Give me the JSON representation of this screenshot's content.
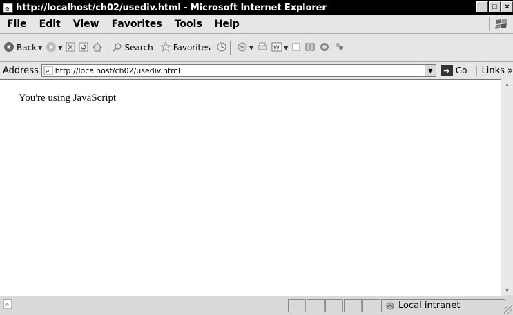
{
  "window": {
    "title": "http://localhost/ch02/usediv.html - Microsoft Internet Explorer",
    "controls": [
      "_",
      "□",
      "×"
    ]
  },
  "menu": {
    "items": [
      "File",
      "Edit",
      "View",
      "Favorites",
      "Tools",
      "Help"
    ]
  },
  "toolbar": {
    "back_label": "Back",
    "search_label": "Search",
    "favorites_label": "Favorites"
  },
  "address": {
    "label": "Address",
    "url": "http://localhost/ch02/usediv.html",
    "go_label": "Go",
    "links_label": "Links"
  },
  "page": {
    "text": "You're using JavaScript"
  },
  "status": {
    "zone_label": "Local intranet"
  },
  "icons": {
    "title": "ie-page-icon",
    "back": "back-arrow-icon",
    "forward": "forward-arrow-icon",
    "stop": "stop-icon",
    "refresh": "refresh-icon",
    "home": "home-icon",
    "search": "search-icon",
    "favorites": "star-icon",
    "history": "history-icon",
    "mail": "mail-icon",
    "print": "printer-icon",
    "edit": "word-edit-icon",
    "discuss": "discuss-icon",
    "research": "research-icon",
    "messenger": "messenger-icon",
    "go": "go-arrow-icon",
    "status_page": "page-done-icon",
    "zone": "intranet-icon"
  }
}
